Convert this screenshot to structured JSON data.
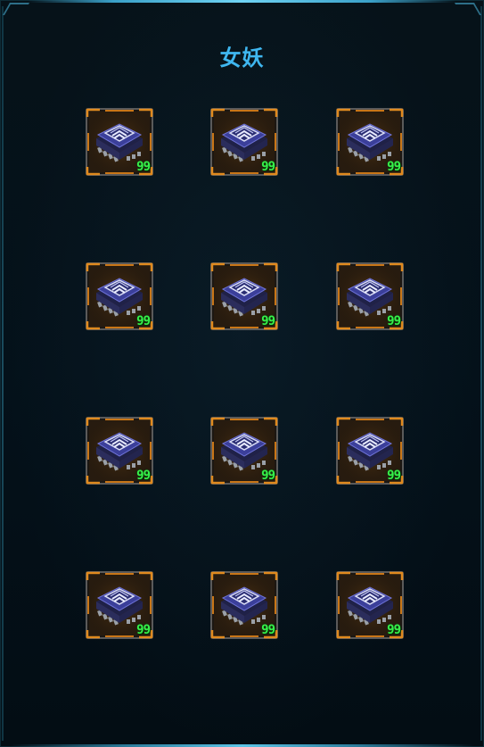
{
  "title": "女妖",
  "colors": {
    "title": "#3fb7f0",
    "quantity": "#37f04a",
    "slot_frame": "#e08a1e",
    "chip": "#3b3f9a"
  },
  "items": [
    {
      "icon": "chip-icon",
      "qty": "99"
    },
    {
      "icon": "chip-icon",
      "qty": "99"
    },
    {
      "icon": "chip-icon",
      "qty": "99"
    },
    {
      "icon": "chip-icon",
      "qty": "99"
    },
    {
      "icon": "chip-icon",
      "qty": "99"
    },
    {
      "icon": "chip-icon",
      "qty": "99"
    },
    {
      "icon": "chip-icon",
      "qty": "99"
    },
    {
      "icon": "chip-icon",
      "qty": "99"
    },
    {
      "icon": "chip-icon",
      "qty": "99"
    },
    {
      "icon": "chip-icon",
      "qty": "99"
    },
    {
      "icon": "chip-icon",
      "qty": "99"
    },
    {
      "icon": "chip-icon",
      "qty": "99"
    }
  ]
}
